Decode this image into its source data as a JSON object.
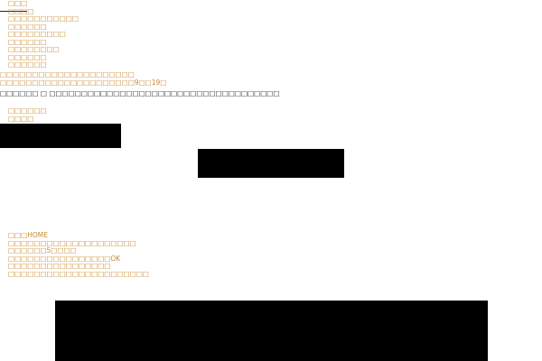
{
  "colors": {
    "link": "#c8892e",
    "text": "#222222",
    "rule": "#222222",
    "image_block": "#000000"
  },
  "top_nav": {
    "items": [
      {
        "label": "□□□"
      },
      {
        "label": "□□□□"
      },
      {
        "label": "□□□□□□□□□□□"
      },
      {
        "label": "□□□□□□"
      },
      {
        "label": "□□□□□□□□□"
      },
      {
        "label": "□□□□□□"
      },
      {
        "label": "□□□□□□□□"
      },
      {
        "label": "□□□□□□"
      },
      {
        "label": "□□□□□□"
      }
    ]
  },
  "contact": {
    "line1": "□□□□□□□□□□□□□□□□□□□□□",
    "line2": "□□□□□□□□□□□□□□□□□□□□□9□□19□",
    "notice": "□□□□□□ □ □□□□□□□□□□□□□□□□□□□□□□□□□□□□□□□□□□□□"
  },
  "secondary_nav": {
    "items": [
      {
        "label": "□□□□□□"
      },
      {
        "label": "□□□□"
      }
    ]
  },
  "footer_nav": {
    "items": [
      {
        "label": "□□□HOME"
      },
      {
        "label": "□□□□□□□□□□□□□□□□□□□□"
      },
      {
        "label": "□□□□□□5□□□□"
      },
      {
        "label": "□□□□□□□□□□□□□□□□OK"
      },
      {
        "label": "□□□□□□□□□□□□□□□□"
      },
      {
        "label": "□□□□□□□□□□□□□□□□□□□□□□"
      }
    ]
  }
}
